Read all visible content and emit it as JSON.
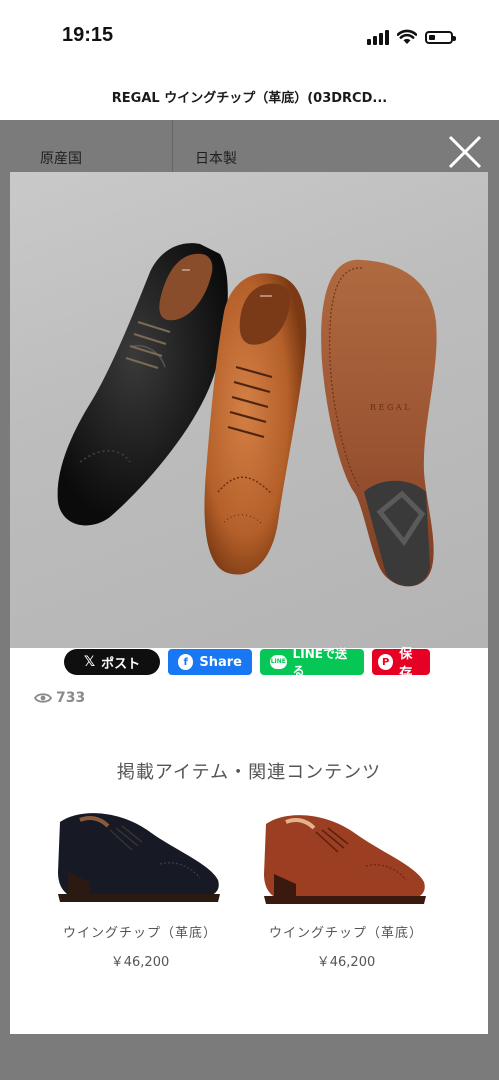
{
  "status_bar": {
    "time": "19:15",
    "icons": [
      "signal-icon",
      "wifi-icon",
      "battery-icon"
    ]
  },
  "header": {
    "title": "REGAL ウイングチップ（革底）(03DRCD..."
  },
  "underlay": {
    "spec_label": "原産国",
    "spec_value": "日本製"
  },
  "share_buttons": [
    {
      "label": "ポスト",
      "icon": "x-logo-icon",
      "color": "#0f0f0f"
    },
    {
      "label": "Share",
      "icon": "facebook-icon",
      "color": "#1877f2"
    },
    {
      "label": "LINEで送る",
      "icon": "line-icon",
      "color": "#06c755"
    },
    {
      "label": "保存",
      "icon": "pinterest-icon",
      "color": "#e60023"
    }
  ],
  "views": {
    "count": "733",
    "icon": "eye-icon"
  },
  "related": {
    "heading": "掲載アイテム・関連コンテンツ",
    "items": [
      {
        "name": "ウイングチップ（革底）",
        "price": "￥46,200",
        "color": "black"
      },
      {
        "name": "ウイングチップ（革底）",
        "price": "￥46,200",
        "color": "brown"
      }
    ]
  }
}
